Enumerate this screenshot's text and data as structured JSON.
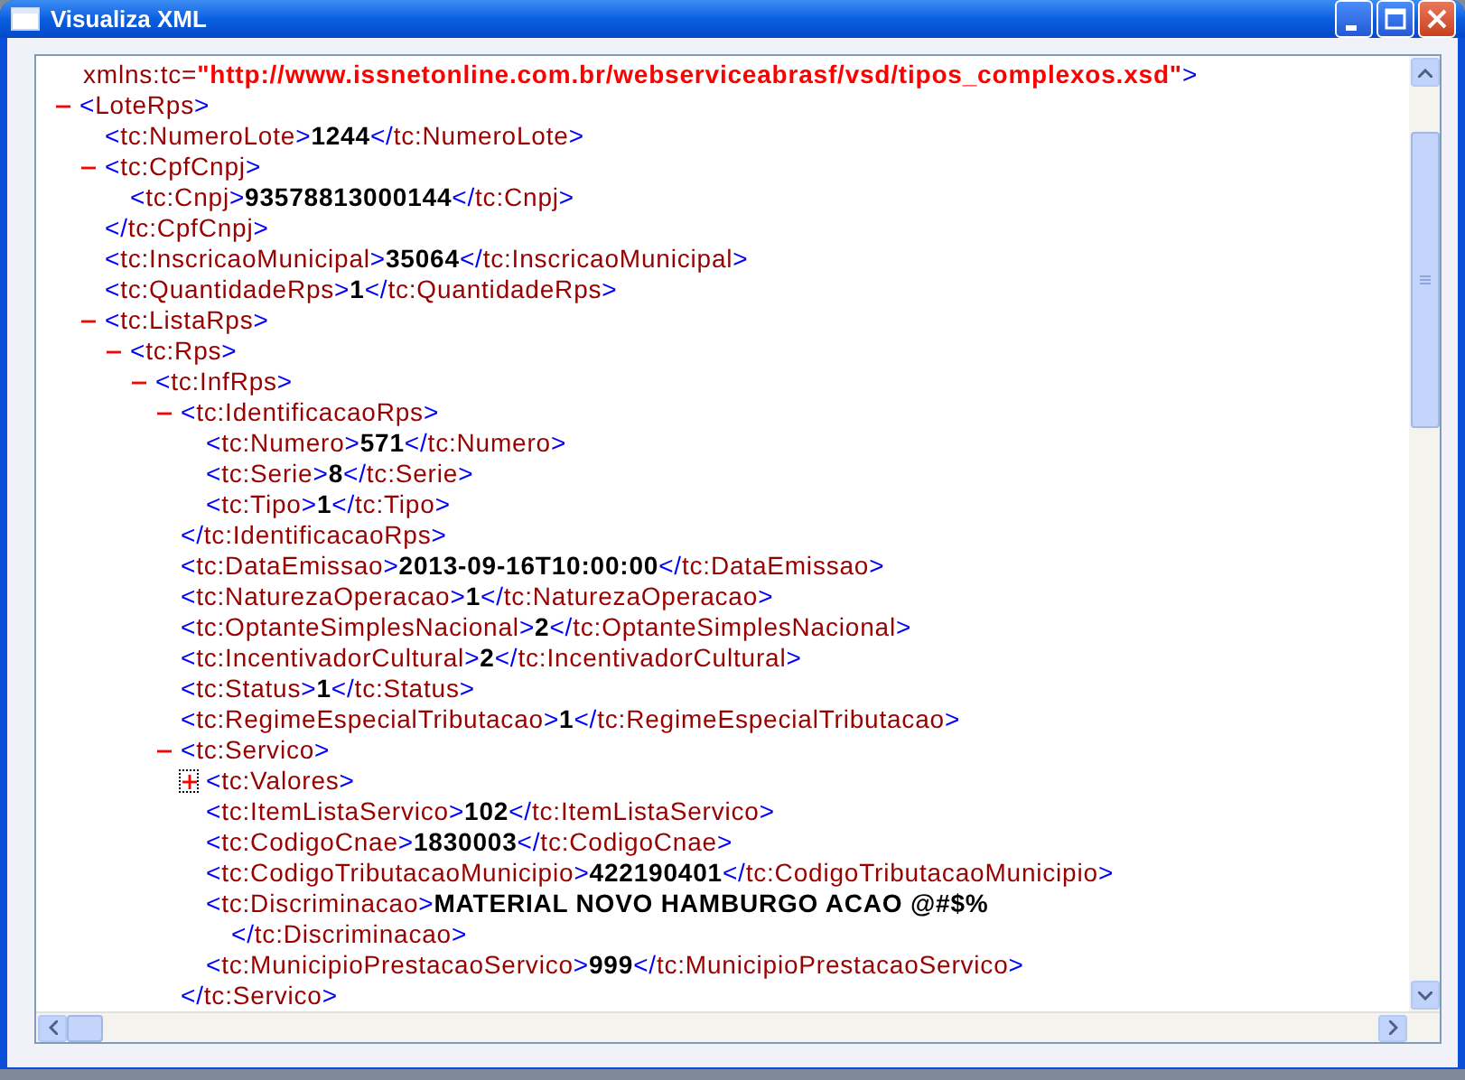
{
  "window": {
    "title": "Visualiza XML"
  },
  "document": {
    "partial_attribute": {
      "name": "xmlns:tc=",
      "value": "\"http://www.issnetonline.com.br/webserviceabrasf/vsd/tipos_complexos.xsd\"",
      "end": ">"
    },
    "nodes": [
      {
        "kind": "element",
        "open": "<LoteRps>",
        "expanded": true,
        "children": [
          {
            "kind": "leaf",
            "open": "<tc:NumeroLote>",
            "value": "1244",
            "close": "</tc:NumeroLote>"
          },
          {
            "kind": "element",
            "open": "<tc:CpfCnpj>",
            "expanded": true,
            "close": "</tc:CpfCnpj>",
            "children": [
              {
                "kind": "leaf",
                "open": "<tc:Cnpj>",
                "value": "93578813000144",
                "close": "</tc:Cnpj>"
              }
            ]
          },
          {
            "kind": "leaf",
            "open": "<tc:InscricaoMunicipal>",
            "value": "35064",
            "close": "</tc:InscricaoMunicipal>"
          },
          {
            "kind": "leaf",
            "open": "<tc:QuantidadeRps>",
            "value": "1",
            "close": "</tc:QuantidadeRps>"
          },
          {
            "kind": "element",
            "open": "<tc:ListaRps>",
            "expanded": true,
            "children": [
              {
                "kind": "element",
                "open": "<tc:Rps>",
                "expanded": true,
                "children": [
                  {
                    "kind": "element",
                    "open": "<tc:InfRps>",
                    "expanded": true,
                    "children": [
                      {
                        "kind": "element",
                        "open": "<tc:IdentificacaoRps>",
                        "expanded": true,
                        "close": "</tc:IdentificacaoRps>",
                        "children": [
                          {
                            "kind": "leaf",
                            "open": "<tc:Numero>",
                            "value": "571",
                            "close": "</tc:Numero>"
                          },
                          {
                            "kind": "leaf",
                            "open": "<tc:Serie>",
                            "value": "8",
                            "close": "</tc:Serie>"
                          },
                          {
                            "kind": "leaf",
                            "open": "<tc:Tipo>",
                            "value": "1",
                            "close": "</tc:Tipo>"
                          }
                        ]
                      },
                      {
                        "kind": "leaf",
                        "open": "<tc:DataEmissao>",
                        "value": "2013-09-16T10:00:00",
                        "close": "</tc:DataEmissao>"
                      },
                      {
                        "kind": "leaf",
                        "open": "<tc:NaturezaOperacao>",
                        "value": "1",
                        "close": "</tc:NaturezaOperacao>"
                      },
                      {
                        "kind": "leaf",
                        "open": "<tc:OptanteSimplesNacional>",
                        "value": "2",
                        "close": "</tc:OptanteSimplesNacional>"
                      },
                      {
                        "kind": "leaf",
                        "open": "<tc:IncentivadorCultural>",
                        "value": "2",
                        "close": "</tc:IncentivadorCultural>"
                      },
                      {
                        "kind": "leaf",
                        "open": "<tc:Status>",
                        "value": "1",
                        "close": "</tc:Status>"
                      },
                      {
                        "kind": "leaf",
                        "open": "<tc:RegimeEspecialTributacao>",
                        "value": "1",
                        "close": "</tc:RegimeEspecialTributacao>"
                      },
                      {
                        "kind": "element",
                        "open": "<tc:Servico>",
                        "expanded": true,
                        "close": "</tc:Servico>",
                        "children": [
                          {
                            "kind": "element",
                            "open": "<tc:Valores>",
                            "expanded": false,
                            "focused": true
                          },
                          {
                            "kind": "leaf",
                            "open": "<tc:ItemListaServico>",
                            "value": "102",
                            "close": "</tc:ItemListaServico>"
                          },
                          {
                            "kind": "leaf",
                            "open": "<tc:CodigoCnae>",
                            "value": "1830003",
                            "close": "</tc:CodigoCnae>"
                          },
                          {
                            "kind": "leaf",
                            "open": "<tc:CodigoTributacaoMunicipio>",
                            "value": "422190401",
                            "close": "</tc:CodigoTributacaoMunicipio>"
                          },
                          {
                            "kind": "leaf",
                            "open": "<tc:Discriminacao>",
                            "value": "MATERIAL NOVO HAMBURGO ACAO @#$%",
                            "close": "</tc:Discriminacao>",
                            "wrapped": true
                          },
                          {
                            "kind": "leaf",
                            "open": "<tc:MunicipioPrestacaoServico>",
                            "value": "999",
                            "close": "</tc:MunicipioPrestacaoServico>"
                          }
                        ]
                      }
                    ]
                  }
                ]
              }
            ]
          }
        ]
      }
    ]
  }
}
